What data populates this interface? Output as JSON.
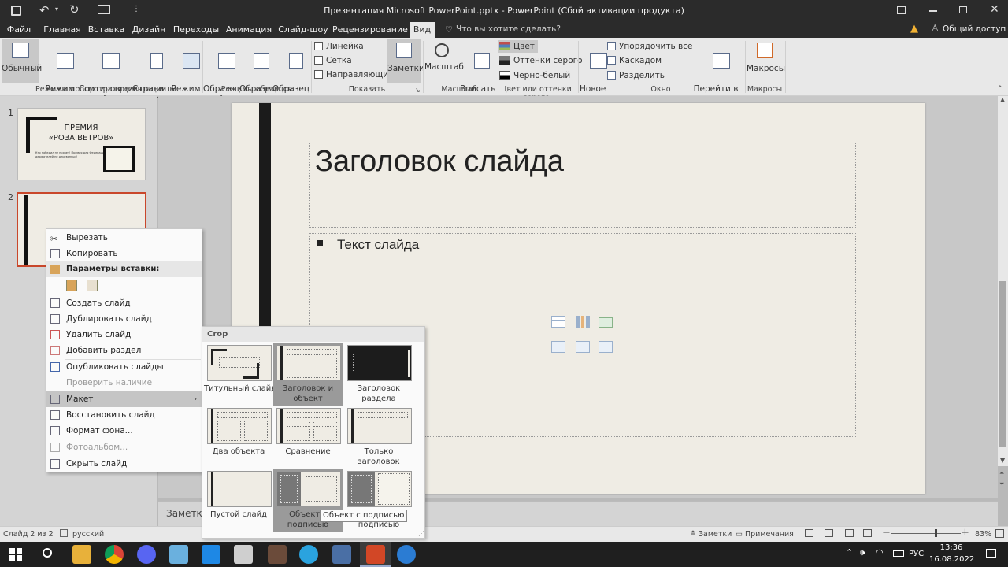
{
  "title_bar": {
    "title": "Презентация Microsoft PowerPoint.pptx - PowerPoint (Сбой активации продукта)"
  },
  "tabs": [
    {
      "label": "Файл",
      "active": false
    },
    {
      "label": "Главная",
      "active": false
    },
    {
      "label": "Вставка",
      "active": false
    },
    {
      "label": "Дизайн",
      "active": false
    },
    {
      "label": "Переходы",
      "active": false
    },
    {
      "label": "Анимация",
      "active": false
    },
    {
      "label": "Слайд-шоу",
      "active": false
    },
    {
      "label": "Рецензирование",
      "active": false
    },
    {
      "label": "Вид",
      "active": true
    }
  ],
  "tell_me": "Что вы хотите сделать?",
  "share": "Общий доступ",
  "ribbon": {
    "views": {
      "normal": "Обычный",
      "outline": "Режим\nструктуры",
      "sorter": "Сортировщик\nслайдов",
      "notes_page": "Страницы\nзаметок",
      "reading": "Режим\nчтения",
      "group": "Режимы просмотра презентации"
    },
    "masters": {
      "slide": "Образец\nслайдов",
      "handout": "Образец\nвыдач",
      "notes": "Образец\nзаметок",
      "group": "Режимы образцов"
    },
    "show": {
      "ruler": "Линейка",
      "grid": "Сетка",
      "guides": "Направляющие",
      "notes": "Заметки",
      "group": "Показать"
    },
    "zoom": {
      "zoom": "Масштаб",
      "fit": "Вписать\nв окно",
      "group": "Масштаб"
    },
    "color": {
      "color": "Цвет",
      "gray": "Оттенки серого",
      "bw": "Черно-белый",
      "group": "Цвет или оттенки серого"
    },
    "window": {
      "new": "Новое\nокно",
      "arrange": "Упорядочить все",
      "cascade": "Каскадом",
      "split": "Разделить",
      "switch": "Перейти в\nдругое окно",
      "group": "Окно"
    },
    "macros": {
      "macros": "Макросы",
      "group": "Макросы"
    }
  },
  "thumbnails": [
    {
      "number": "1",
      "title_line1": "ПРЕМИЯ",
      "title_line2": "«РОЗА ВЕТРОВ»",
      "subtitle": "Кто победил не прячет! Премия для Федерации\nдержателей не деревянных!"
    },
    {
      "number": "2"
    }
  ],
  "slide": {
    "title": "Заголовок слайда",
    "bullet": "Текст слайда"
  },
  "notes_placeholder": "Заметки",
  "context_menu": {
    "items": [
      "Вырезать",
      "Копировать",
      "Параметры вставки:",
      "Создать слайд",
      "Дублировать слайд",
      "Удалить слайд",
      "Добавить раздел",
      "Опубликовать слайды",
      "Проверить наличие обновлений",
      "Макет",
      "Восстановить слайд",
      "Формат фона...",
      "Фотоальбом...",
      "Скрыть слайд"
    ]
  },
  "layout_gallery": {
    "header": "Crop",
    "layouts": [
      "Титульный слайд",
      "Заголовок и\nобъект",
      "Заголовок\nраздела",
      "Два объекта",
      "Сравнение",
      "Только\nзаголовок",
      "Пустой слайд",
      "Объект с\nподписью",
      "Рисунок с\nподписью"
    ],
    "tooltip": "Объект с подписью"
  },
  "status": {
    "slide": "Слайд 2 из 2",
    "lang": "русский",
    "notes": "Заметки",
    "comments": "Примечания",
    "zoom": "83%"
  },
  "taskbar": {
    "time": "13:36",
    "date": "16.08.2022",
    "lang": "РУС"
  }
}
